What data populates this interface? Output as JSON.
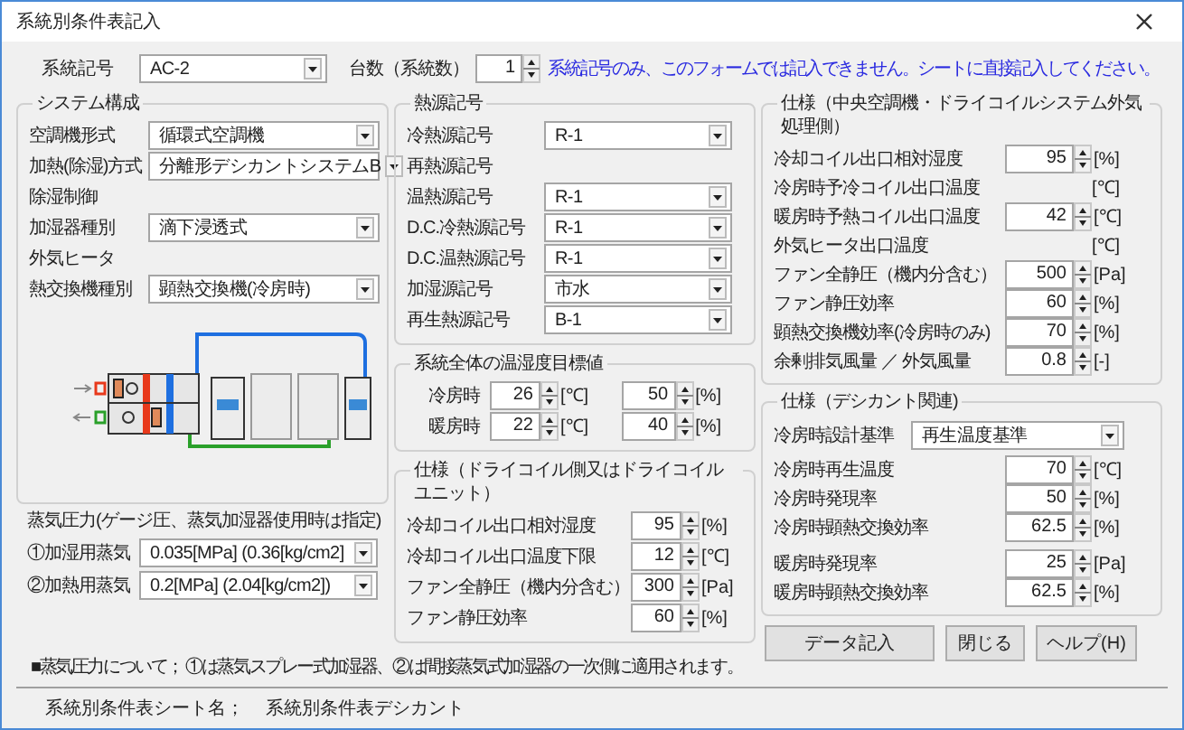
{
  "window": {
    "title": "系統別条件表記入"
  },
  "system_code": {
    "label": "系統記号",
    "value": "AC-2"
  },
  "unit_count": {
    "label": "台数（系統数）",
    "value": "1"
  },
  "notice": "系統記号のみ、このフォームでは記入できません。シートに直接記入してください。",
  "system_config": {
    "title": "システム構成",
    "rows": [
      {
        "kind": "combo",
        "label": "空調機形式",
        "value": "循環式空調機"
      },
      {
        "kind": "combo",
        "label": "加熱(除湿)方式",
        "value": "分離形デシカントシステムB"
      },
      {
        "kind": "label",
        "label": "除湿制御"
      },
      {
        "kind": "combo",
        "label": "加湿器種別",
        "value": "滴下浸透式"
      },
      {
        "kind": "label",
        "label": "外気ヒータ"
      },
      {
        "kind": "combo",
        "label": "熱交換機種別",
        "value": "顕熱交換機(冷房時)"
      }
    ]
  },
  "steam": {
    "title": "蒸気圧力(ゲージ圧、蒸気加湿器使用時は指定)",
    "rows": [
      {
        "label": "①加湿用蒸気",
        "value": "0.035[MPa] (0.36[kg/cm2]"
      },
      {
        "label": "②加熱用蒸気",
        "value": "0.2[MPa] (2.04[kg/cm2])"
      }
    ]
  },
  "steam_note": "■蒸気圧力について；  ①は蒸気スプレー式加湿器、②は間接蒸気式加湿器の一次側に適用されます。",
  "heat_source": {
    "title": "熱源記号",
    "rows": [
      {
        "kind": "combo",
        "label": "冷熱源記号",
        "value": "R-1"
      },
      {
        "kind": "label",
        "label": "再熱源記号"
      },
      {
        "kind": "combo",
        "label": "温熱源記号",
        "value": "R-1"
      },
      {
        "kind": "combo",
        "label": "D.C.冷熱源記号",
        "value": "R-1"
      },
      {
        "kind": "combo",
        "label": "D.C.温熱源記号",
        "value": "R-1"
      },
      {
        "kind": "combo",
        "label": "加湿源記号",
        "value": "市水"
      },
      {
        "kind": "combo",
        "label": "再生熱源記号",
        "value": "B-1"
      }
    ]
  },
  "targets": {
    "title": "系統全体の温湿度目標値",
    "rows": [
      {
        "label": "冷房時",
        "temp": "26",
        "temp_unit": "[℃]",
        "humidity": "50",
        "humidity_unit": "[%]"
      },
      {
        "label": "暖房時",
        "temp": "22",
        "temp_unit": "[℃]",
        "humidity": "40",
        "humidity_unit": "[%]"
      }
    ]
  },
  "dry_coil": {
    "title": "仕様（ドライコイル側又はドライコイルユニット）",
    "rows": [
      {
        "kind": "spin",
        "label": "冷却コイル出口相対湿度",
        "value": "95",
        "unit": "[%]"
      },
      {
        "kind": "spin",
        "label": "冷却コイル出口温度下限",
        "value": "12",
        "unit": "[℃]"
      },
      {
        "kind": "spin",
        "label": "ファン全静圧（機内分含む）",
        "value": "300",
        "unit": "[Pa]"
      },
      {
        "kind": "spin",
        "label": "ファン静圧効率",
        "value": "60",
        "unit": "[%]"
      }
    ]
  },
  "central": {
    "title": "仕様（中央空調機・ドライコイルシステム外気処理側）",
    "rows": [
      {
        "kind": "spin",
        "label": "冷却コイル出口相対湿度",
        "value": "95",
        "unit": "[%]"
      },
      {
        "kind": "label",
        "label": "冷房時予冷コイル出口温度",
        "unit": "[℃]"
      },
      {
        "kind": "spin",
        "label": "暖房時予熱コイル出口温度",
        "value": "42",
        "unit": "[℃]"
      },
      {
        "kind": "label",
        "label": "外気ヒータ出口温度",
        "unit": "[℃]"
      },
      {
        "kind": "spin",
        "label": "ファン全静圧（機内分含む）",
        "value": "500",
        "unit": "[Pa]"
      },
      {
        "kind": "spin",
        "label": "ファン静圧効率",
        "value": "60",
        "unit": "[%]"
      },
      {
        "kind": "spin",
        "label": "顕熱交換機効率(冷房時のみ)",
        "value": "70",
        "unit": "[%]"
      },
      {
        "kind": "spin",
        "label": "余剰排気風量 ／ 外気風量",
        "value": "0.8",
        "unit": "[-]"
      }
    ]
  },
  "desiccant": {
    "title": "仕様（デシカント関連)",
    "design_basis": {
      "label": "冷房時設計基準",
      "value": "再生温度基準"
    },
    "cooling": [
      {
        "label": "冷房時再生温度",
        "value": "70",
        "unit": "[℃]"
      },
      {
        "label": "冷房時発現率",
        "value": "50",
        "unit": "[%]"
      },
      {
        "label": "冷房時顕熱交換効率",
        "value": "62.5",
        "unit": "[%]"
      }
    ],
    "heating": [
      {
        "label": "暖房時発現率",
        "value": "25",
        "unit": "[Pa]"
      },
      {
        "label": "暖房時顕熱交換効率",
        "value": "62.5",
        "unit": "[%]"
      }
    ]
  },
  "buttons": [
    "データ記入",
    "閉じる",
    "ヘルプ(H)"
  ],
  "status_bar": {
    "label": "系統別条件表シート名；",
    "value": "系統別条件表デシカント"
  }
}
